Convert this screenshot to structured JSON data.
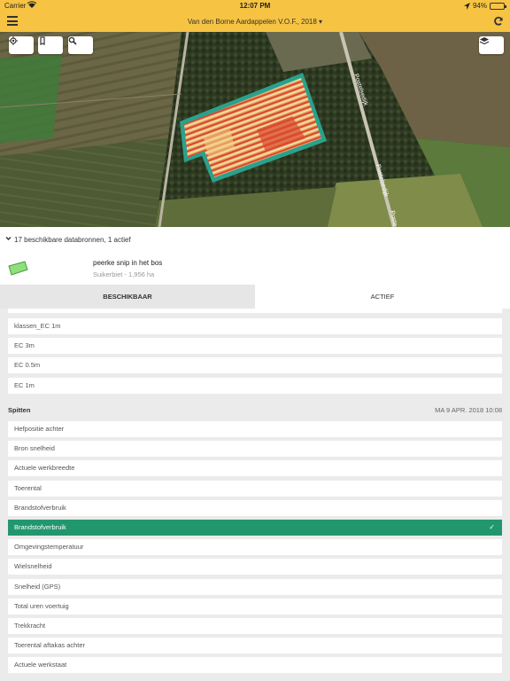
{
  "status_bar": {
    "carrier": "Carrier",
    "time": "12:07 PM",
    "battery_percent": "94%",
    "battery_level": 0.94
  },
  "nav": {
    "menu_icon": "hamburger-menu-icon",
    "title": "Van den Borne Aardappelen V.O.F., 2018 ▾",
    "refresh_icon": "refresh-icon"
  },
  "map_tools": {
    "locate_icon": "locate-icon",
    "field_icon": "field-icon",
    "search_icon": "search-icon",
    "layers_icon": "layers-icon"
  },
  "map": {
    "street_labels": [
      "Postelsedijk",
      "Postelsedijk",
      "Poste"
    ]
  },
  "sources": {
    "label": "17 beschikbare databronnen, 1 actief"
  },
  "field": {
    "name": "peerke snip in het bos",
    "subtitle": "Suikerbiet - 1,956 ha",
    "color": "#8fe07a"
  },
  "tabs": {
    "available": "BESCHIKBAAR",
    "active": "ACTIEF"
  },
  "list": {
    "pre_items": [
      "klassen_EC 1m",
      "EC 3m",
      "EC 0.5m",
      "EC 1m"
    ],
    "group": {
      "name": "Spitten",
      "date": "MA 9 APR. 2018 10:08"
    },
    "items": [
      "Hefpositie achter",
      "Bron snelheid",
      "Actuele werkbreedte",
      "Toerental",
      "Brandstofverbruik",
      "Brandstofverbruik",
      "Omgevingstemperatuur",
      "Wielsnelheid",
      "Snelheid (GPS)",
      "Total uren voertuig",
      "Trekkracht",
      "Toerental aftakas achter",
      "Actuele werkstaat"
    ],
    "selected_index": 5,
    "selected_color": "#22976e"
  }
}
